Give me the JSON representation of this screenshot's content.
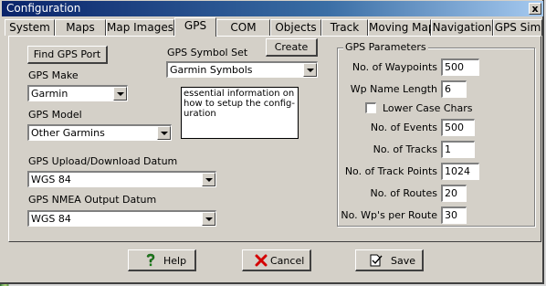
{
  "window": {
    "title": "Configuration",
    "close_glyph": "x"
  },
  "tabs": [
    {
      "label": "System"
    },
    {
      "label": "Maps"
    },
    {
      "label": "Map Images"
    },
    {
      "label": "GPS"
    },
    {
      "label": "COM"
    },
    {
      "label": "Objects"
    },
    {
      "label": "Track"
    },
    {
      "label": "Moving Map"
    },
    {
      "label": "Navigation"
    },
    {
      "label": "GPS Sim"
    }
  ],
  "active_tab": "GPS",
  "left": {
    "find_port_label": "Find GPS Port",
    "make_label": "GPS Make",
    "make_value": "Garmin",
    "model_label": "GPS Model",
    "model_value": "Other Garmins",
    "upload_datum_label": "GPS Upload/Download Datum",
    "upload_datum_value": "WGS 84",
    "nmea_datum_label": "GPS NMEA Output Datum",
    "nmea_datum_value": "WGS 84"
  },
  "symbols": {
    "label": "GPS Symbol Set",
    "create_label": "Create",
    "value": "Garmin Symbols",
    "note": "essential information on how to setup the config-uration"
  },
  "params": {
    "title": "GPS Parameters",
    "waypoints_label": "No. of Waypoints",
    "waypoints_value": "500",
    "wp_name_length_label": "Wp Name Length",
    "wp_name_length_value": "6",
    "lower_case_label": "Lower Case Chars",
    "lower_case_checked": false,
    "events_label": "No. of Events",
    "events_value": "500",
    "tracks_label": "No. of Tracks",
    "tracks_value": "1",
    "track_points_label": "No. of Track Points",
    "track_points_value": "1024",
    "routes_label": "No. of Routes",
    "routes_value": "20",
    "wps_per_route_label": "No. Wp's per Route",
    "wps_per_route_value": "30"
  },
  "footer": {
    "help_label": "Help",
    "cancel_label": "Cancel",
    "save_label": "Save"
  },
  "colors": {
    "titlebar_start": "#0a246a",
    "titlebar_end": "#a6caf0",
    "face": "#d4d0c8",
    "cancel_icon": "#d40000",
    "help_icon": "#1a7a1a"
  }
}
